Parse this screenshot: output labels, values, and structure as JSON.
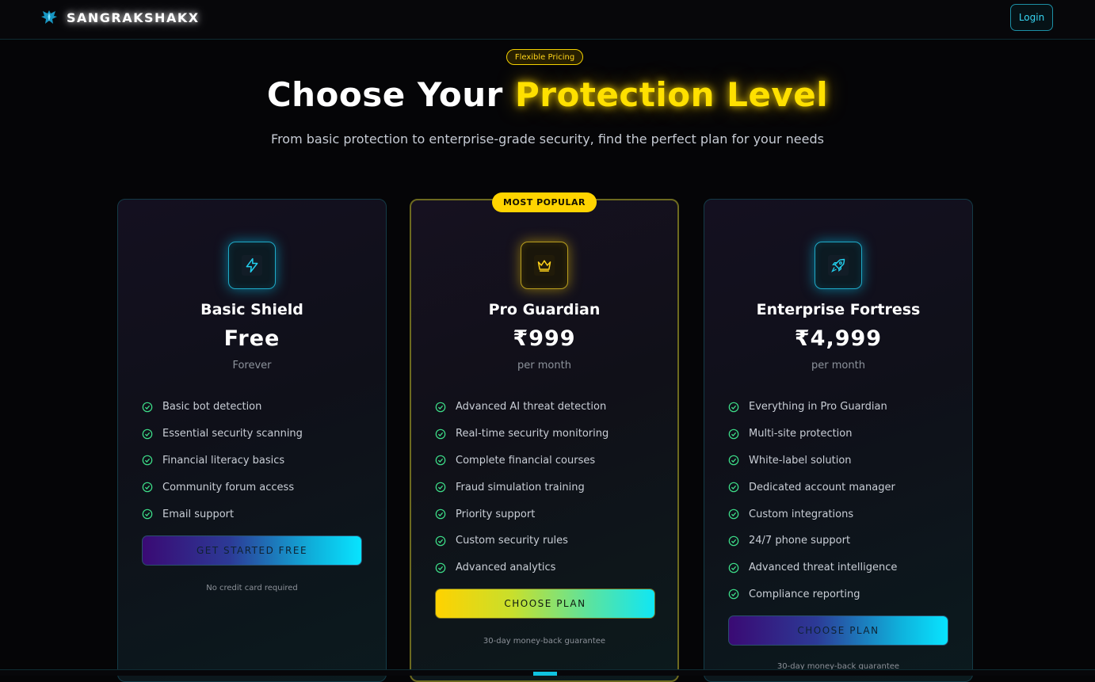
{
  "nav": {
    "brand": "SANGRAKSHAKX",
    "login_label": "Login"
  },
  "hero": {
    "pill": "Flexible Pricing",
    "title_prefix": "Choose Your",
    "title_highlight": "Protection Level",
    "subtitle": "From basic protection to enterprise-grade security, find the perfect plan for your needs"
  },
  "plans": [
    {
      "name": "Basic Shield",
      "price": "Free",
      "period": "Forever",
      "icon": "lightning-icon",
      "features": [
        "Basic bot detection",
        "Essential security scanning",
        "Financial literacy basics",
        "Community forum access",
        "Email support"
      ],
      "cta": "GET STARTED FREE",
      "note": "No credit card required"
    },
    {
      "name": "Pro Guardian",
      "badge": "MOST POPULAR",
      "price": "₹999",
      "period": "per month",
      "icon": "crown-icon",
      "features": [
        "Advanced AI threat detection",
        "Real-time security monitoring",
        "Complete financial courses",
        "Fraud simulation training",
        "Priority support",
        "Custom security rules",
        "Advanced analytics"
      ],
      "cta": "CHOOSE PLAN",
      "note": "30-day money-back guarantee"
    },
    {
      "name": "Enterprise Fortress",
      "price": "₹4,999",
      "period": "per month",
      "icon": "rocket-icon",
      "features": [
        "Everything in Pro Guardian",
        "Multi-site protection",
        "White-label solution",
        "Dedicated account manager",
        "Custom integrations",
        "24/7 phone support",
        "Advanced threat intelligence",
        "Compliance reporting"
      ],
      "cta": "CHOOSE PLAN",
      "note": "30-day money-back guarantee"
    }
  ],
  "colors": {
    "accent_cyan": "#08e4ff",
    "accent_yellow": "#ffd400",
    "check_green": "#3ee08a",
    "background": "#050507"
  }
}
